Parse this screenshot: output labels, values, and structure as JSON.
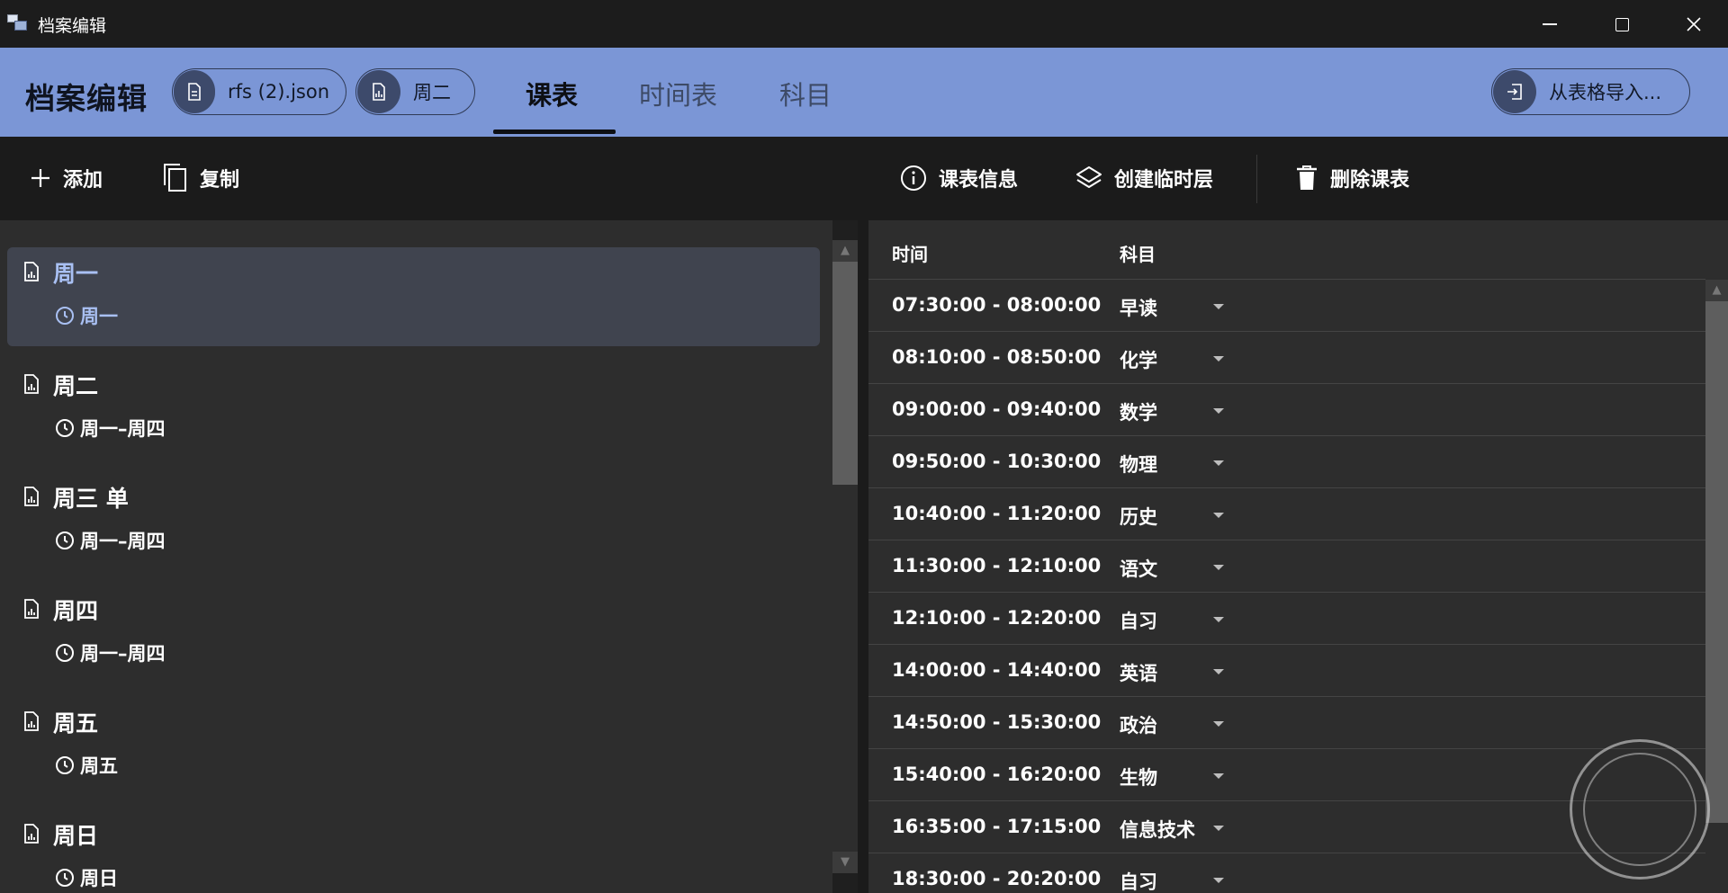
{
  "window": {
    "title": "档案编辑"
  },
  "header": {
    "title": "档案编辑",
    "file_chip": "rfs (2).json",
    "day_chip": "周二",
    "tabs": [
      {
        "label": "课表",
        "active": true
      },
      {
        "label": "时间表",
        "active": false
      },
      {
        "label": "科目",
        "active": false
      }
    ],
    "import_button": "从表格导入..."
  },
  "left_toolbar": {
    "add_label": "添加",
    "copy_label": "复制"
  },
  "schedule_list": [
    {
      "name": "周一",
      "timetable": "周一",
      "selected": true
    },
    {
      "name": "周二",
      "timetable": "周一–周四",
      "selected": false
    },
    {
      "name": "周三 单",
      "timetable": "周一–周四",
      "selected": false
    },
    {
      "name": "周四",
      "timetable": "周一–周四",
      "selected": false
    },
    {
      "name": "周五",
      "timetable": "周五",
      "selected": false
    },
    {
      "name": "周日",
      "timetable": "周日",
      "selected": false
    }
  ],
  "right_toolbar": {
    "info_label": "课表信息",
    "layer_label": "创建临时层",
    "delete_label": "删除课表"
  },
  "table": {
    "headers": [
      "时间",
      "科目"
    ],
    "rows": [
      {
        "time": "07:30:00 - 08:00:00",
        "subject": "早读"
      },
      {
        "time": "08:10:00 - 08:50:00",
        "subject": "化学"
      },
      {
        "time": "09:00:00 - 09:40:00",
        "subject": "数学"
      },
      {
        "time": "09:50:00 - 10:30:00",
        "subject": "物理"
      },
      {
        "time": "10:40:00 - 11:20:00",
        "subject": "历史"
      },
      {
        "time": "11:30:00 - 12:10:00",
        "subject": "语文"
      },
      {
        "time": "12:10:00 - 12:20:00",
        "subject": "自习"
      },
      {
        "time": "14:00:00 - 14:40:00",
        "subject": "英语"
      },
      {
        "time": "14:50:00 - 15:30:00",
        "subject": "政治"
      },
      {
        "time": "15:40:00 - 16:20:00",
        "subject": "生物"
      },
      {
        "time": "16:35:00 - 17:15:00",
        "subject": "信息技术"
      },
      {
        "time": "18:30:00 - 20:20:00",
        "subject": "自习"
      }
    ]
  },
  "colors": {
    "header_bg": "#7b96d6",
    "selected_item_text": "#a9c0f3",
    "panel_bg": "#2d2d2d",
    "toolbar_bg": "#1b1b1b"
  }
}
